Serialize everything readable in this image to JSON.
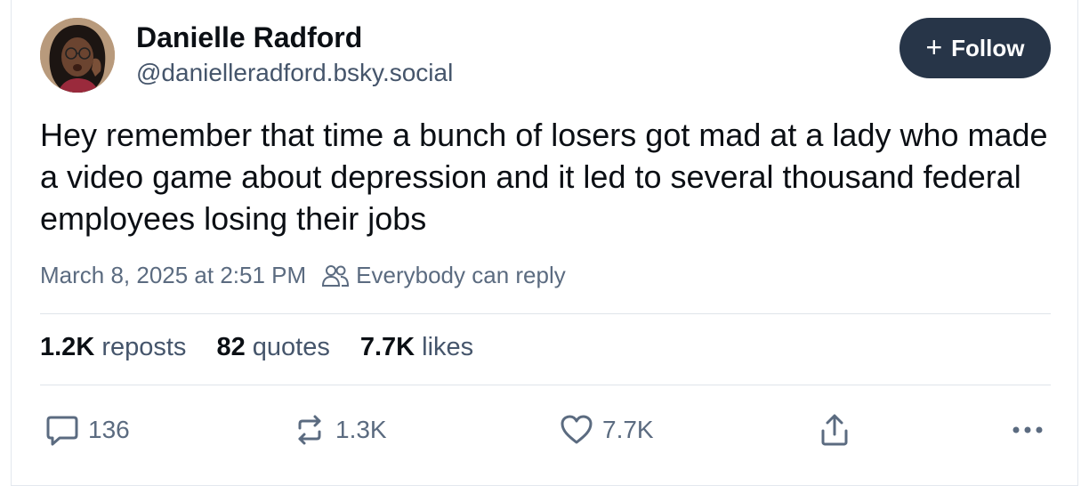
{
  "author": {
    "name": "Danielle Radford",
    "handle": "@danielleradford.bsky.social"
  },
  "follow_button": {
    "icon": "plus-icon",
    "label": "Follow"
  },
  "post": {
    "text": "Hey remember that time a bunch of losers got mad at a lady who made a video game about depression and it led to several thousand federal employees losing their jobs",
    "timestamp": "March 8, 2025 at 2:51 PM",
    "reply_setting": "Everybody can reply"
  },
  "stats": {
    "reposts_count": "1.2K",
    "reposts_label": "reposts",
    "quotes_count": "82",
    "quotes_label": "quotes",
    "likes_count": "7.7K",
    "likes_label": "likes"
  },
  "actions": {
    "reply_count": "136",
    "repost_count": "1.3K",
    "like_count": "7.7K"
  },
  "colors": {
    "follow_button_bg": "#273548",
    "secondary_text": "#45556b",
    "meta_text": "#5b6b80"
  }
}
